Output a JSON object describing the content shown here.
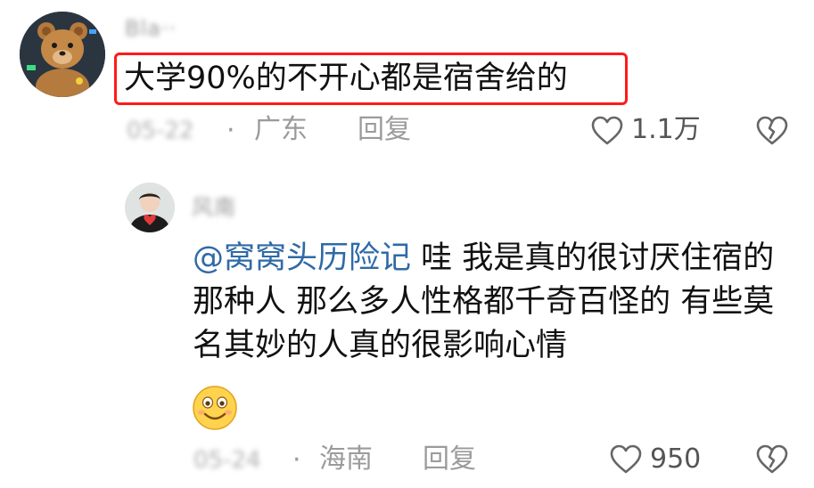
{
  "comment": {
    "username": "Bla··",
    "text": "大学90%的不开心都是宿舍给的",
    "date": "05-22",
    "separator": "·",
    "location": "广东",
    "reply_label": "回复",
    "likes": "1.1万"
  },
  "reply": {
    "username": "风南",
    "mention": "@窝窝头历险记",
    "text": " 哇 我是真的很讨厌住宿的那种人 那么多人性格都千奇百怪的 有些莫名其妙的人真的很影响心情",
    "emoji": "smiling-face-emoji",
    "date": "05-24",
    "separator": "·",
    "location": "海南",
    "reply_label": "回复",
    "likes": "950"
  },
  "icons": {
    "like": "heart-outline-icon",
    "dislike": "broken-heart-icon"
  },
  "colors": {
    "highlight_border": "#ff1a1a",
    "mention": "#2f6aa6",
    "meta_text": "#9b9b9b"
  }
}
